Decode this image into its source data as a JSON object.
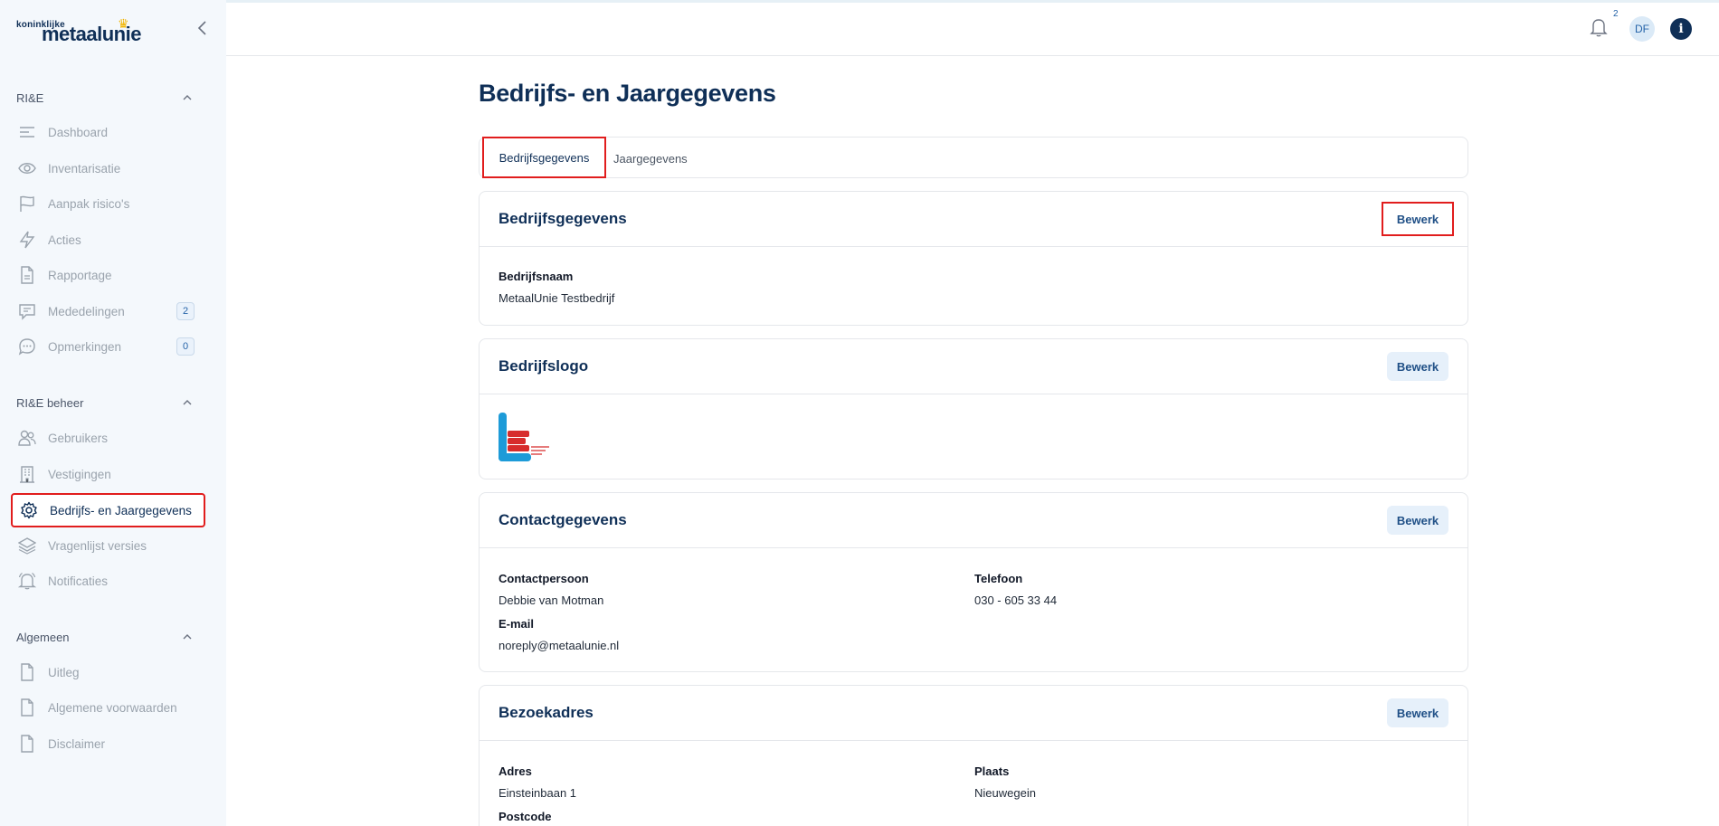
{
  "sidebar": {
    "logo_small": "koninklijke",
    "logo_big": "metaalunie",
    "sections": [
      {
        "title": "RI&E",
        "items": [
          {
            "label": "Dashboard",
            "icon": "bars-icon"
          },
          {
            "label": "Inventarisatie",
            "icon": "eye-icon"
          },
          {
            "label": "Aanpak risico's",
            "icon": "flag-icon"
          },
          {
            "label": "Acties",
            "icon": "lightning-icon"
          },
          {
            "label": "Rapportage",
            "icon": "document-icon"
          },
          {
            "label": "Mededelingen",
            "icon": "message-icon",
            "badge": "2"
          },
          {
            "label": "Opmerkingen",
            "icon": "comment-icon",
            "badge": "0"
          }
        ]
      },
      {
        "title": "RI&E beheer",
        "items": [
          {
            "label": "Gebruikers",
            "icon": "users-icon"
          },
          {
            "label": "Vestigingen",
            "icon": "building-icon"
          },
          {
            "label": "Bedrijfs- en Jaargegevens",
            "icon": "gear-icon",
            "active": true
          },
          {
            "label": "Vragenlijst versies",
            "icon": "layers-icon"
          },
          {
            "label": "Notificaties",
            "icon": "bell-icon"
          }
        ]
      },
      {
        "title": "Algemeen",
        "items": [
          {
            "label": "Uitleg",
            "icon": "document-icon"
          },
          {
            "label": "Algemene voorwaarden",
            "icon": "document-icon"
          },
          {
            "label": "Disclaimer",
            "icon": "document-icon"
          }
        ]
      }
    ]
  },
  "header": {
    "notification_count": "2",
    "avatar_initials": "DF",
    "info_label": "i"
  },
  "page": {
    "title": "Bedrijfs- en Jaargegevens",
    "tabs": [
      {
        "label": "Bedrijfsgegevens",
        "active": true
      },
      {
        "label": "Jaargegevens",
        "active": false
      }
    ]
  },
  "cards": {
    "edit_label": "Bewerk",
    "bedrijfsgegevens": {
      "title": "Bedrijfsgegevens",
      "fields": [
        {
          "label": "Bedrijfsnaam",
          "value": "MetaalUnie Testbedrijf"
        }
      ]
    },
    "bedrijfslogo": {
      "title": "Bedrijfslogo"
    },
    "contactgegevens": {
      "title": "Contactgegevens",
      "fields": [
        {
          "label": "Contactpersoon",
          "value": "Debbie van Motman"
        },
        {
          "label": "Telefoon",
          "value": "030 - 605 33 44"
        },
        {
          "label": "E-mail",
          "value": "noreply@metaalunie.nl"
        }
      ]
    },
    "bezoekadres": {
      "title": "Bezoekadres",
      "fields": [
        {
          "label": "Adres",
          "value": "Einsteinbaan 1"
        },
        {
          "label": "Plaats",
          "value": "Nieuwegein"
        },
        {
          "label": "Postcode",
          "value": ""
        }
      ]
    }
  },
  "colors": {
    "navy": "#0f2f57",
    "sidebar_bg": "#f4f8fc",
    "highlight_red": "#e11d1d",
    "button_bg": "#e6f0fa"
  }
}
